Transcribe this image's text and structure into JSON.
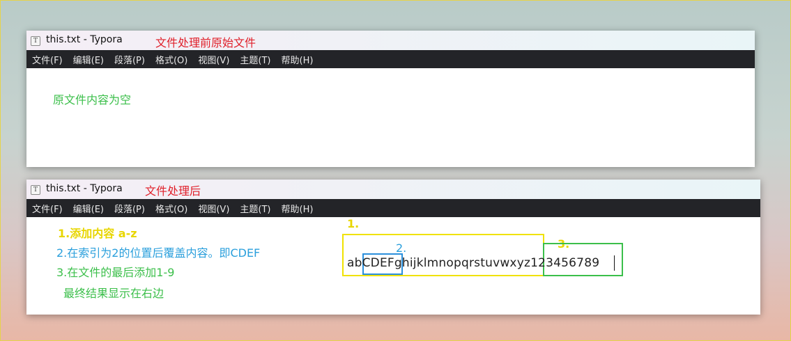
{
  "top_window": {
    "title": "this.txt - Typora",
    "note": "文件处理前原始文件",
    "content_text": "原文件内容为空"
  },
  "menu": [
    "文件(F)",
    "编辑(E)",
    "段落(P)",
    "格式(O)",
    "视图(V)",
    "主题(T)",
    "帮助(H)"
  ],
  "bottom_window": {
    "title": "this.txt - Typora",
    "note": "文件处理后",
    "steps": {
      "step1": "1.添加内容 a-z",
      "step2": "2.在索引为2的位置后覆盖内容。即CDEF",
      "step3": "3.在文件的最后添加1-9",
      "result": "最终结果显示在右边"
    },
    "labels": {
      "l1": "1.",
      "l2": "2.",
      "l3": "3."
    },
    "document_text": "abCDEFghijklmnopqrstuvwxyz123456789"
  },
  "colors": {
    "note_red": "#e0202a",
    "green": "#3bbf4a",
    "yellow": "#e8d600",
    "blue": "#2a9fdc"
  }
}
